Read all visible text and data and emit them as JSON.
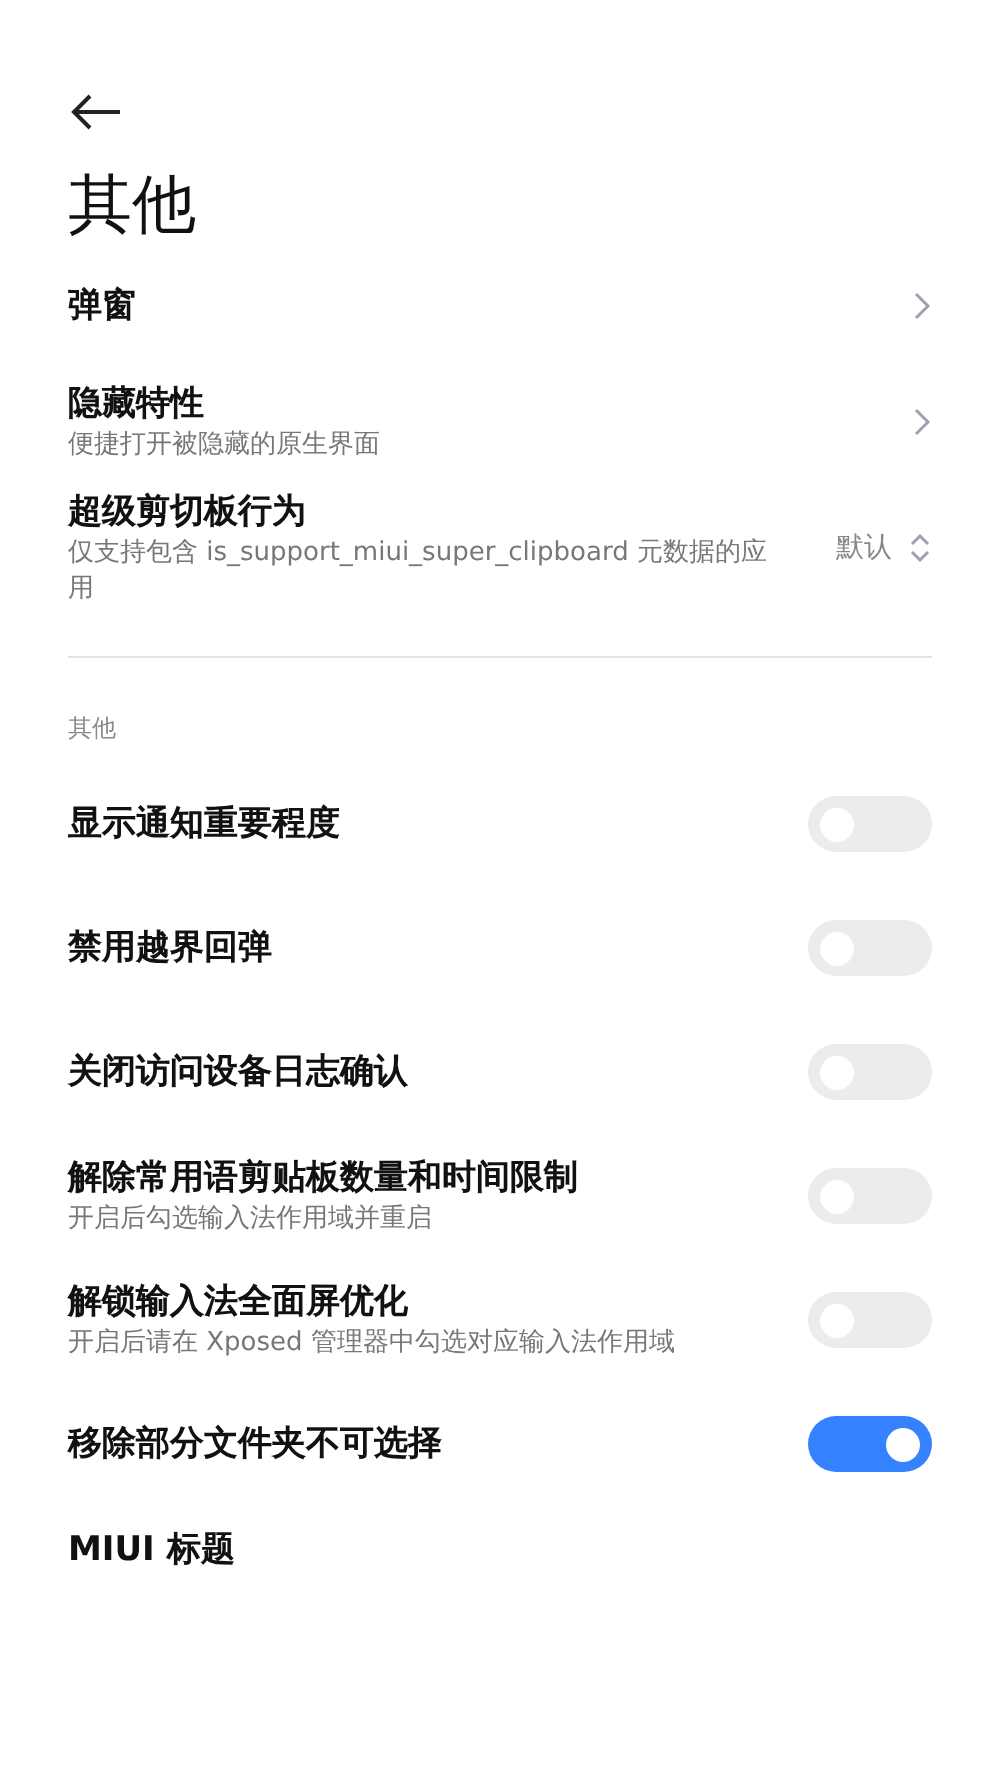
{
  "title": "其他",
  "nav_items": [
    {
      "kind": "link",
      "label": "弹窗"
    },
    {
      "kind": "link",
      "label": "隐藏特性",
      "subtitle": "便捷打开被隐藏的原生界面"
    },
    {
      "kind": "select",
      "label": "超级剪切板行为",
      "subtitle": "仅支持包含 is_support_miui_super_clipboard 元数据的应用",
      "value": "默认"
    }
  ],
  "section_header": "其他",
  "toggles": [
    {
      "label": "显示通知重要程度",
      "on": false
    },
    {
      "label": "禁用越界回弹",
      "on": false
    },
    {
      "label": "关闭访问设备日志确认",
      "on": false
    },
    {
      "label": "解除常用语剪贴板数量和时间限制",
      "subtitle": "开启后勾选输入法作用域并重启",
      "on": false
    },
    {
      "label": "解锁输入法全面屏优化",
      "subtitle": "开启后请在 Xposed 管理器中勾选对应输入法作用域",
      "on": false
    },
    {
      "label": "移除部分文件夹不可选择",
      "on": true
    }
  ],
  "next_item": {
    "label": "MIUI 标题"
  }
}
